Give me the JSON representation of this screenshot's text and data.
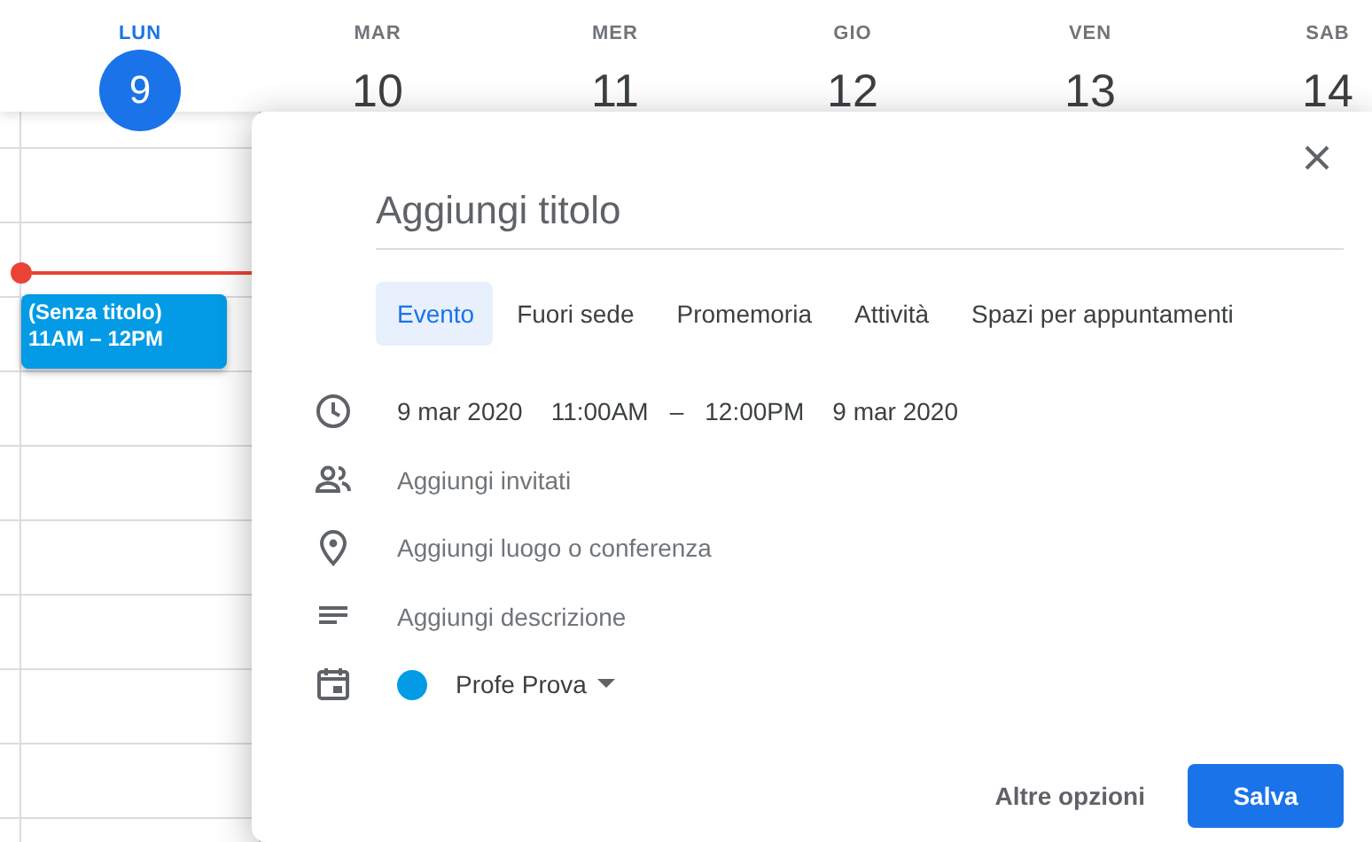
{
  "days": [
    {
      "label": "LUN",
      "number": "9",
      "selected": true
    },
    {
      "label": "MAR",
      "number": "10",
      "selected": false
    },
    {
      "label": "MER",
      "number": "11",
      "selected": false
    },
    {
      "label": "GIO",
      "number": "12",
      "selected": false
    },
    {
      "label": "VEN",
      "number": "13",
      "selected": false
    },
    {
      "label": "SAB",
      "number": "14",
      "selected": false
    }
  ],
  "event": {
    "title": "(Senza titolo)",
    "time": "11AM – 12PM",
    "color": "#039be5"
  },
  "dialog": {
    "title": {
      "placeholder": "Aggiungi titolo"
    },
    "tabs": [
      {
        "label": "Evento",
        "selected": true
      },
      {
        "label": "Fuori sede",
        "selected": false
      },
      {
        "label": "Promemoria",
        "selected": false
      },
      {
        "label": "Attività",
        "selected": false
      },
      {
        "label": "Spazi per appuntamenti",
        "selected": false
      }
    ],
    "details": [
      {
        "kind": "datetime",
        "parts": [
          "9 mar 2020",
          "11:00AM",
          "–",
          "12:00PM",
          "9 mar 2020"
        ]
      },
      {
        "kind": "guests",
        "text": "Aggiungi invitati"
      },
      {
        "kind": "location",
        "text": "Aggiungi luogo o conferenza"
      },
      {
        "kind": "description",
        "text": "Aggiungi descrizione"
      },
      {
        "kind": "calendar",
        "text": "Profe Prova",
        "color": "#039be5"
      }
    ],
    "more_button": "Altre opzioni",
    "save_button": "Salva"
  }
}
